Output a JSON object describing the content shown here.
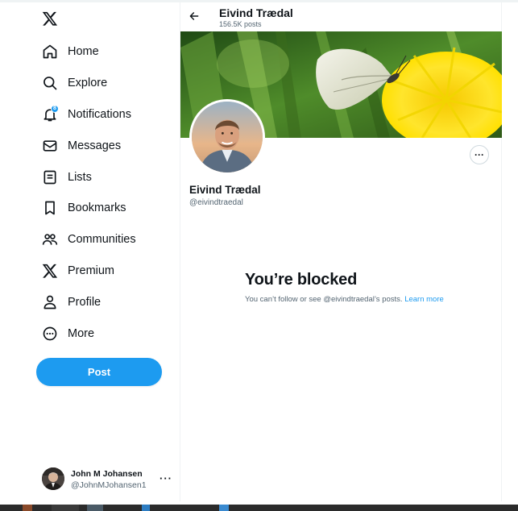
{
  "sidebar": {
    "items": [
      {
        "label": "Home",
        "icon": "home-icon"
      },
      {
        "label": "Explore",
        "icon": "search-icon"
      },
      {
        "label": "Notifications",
        "icon": "bell-icon",
        "badge": "8"
      },
      {
        "label": "Messages",
        "icon": "mail-icon"
      },
      {
        "label": "Lists",
        "icon": "list-icon"
      },
      {
        "label": "Bookmarks",
        "icon": "bookmark-icon"
      },
      {
        "label": "Communities",
        "icon": "communities-icon"
      },
      {
        "label": "Premium",
        "icon": "x-logo-icon"
      },
      {
        "label": "Profile",
        "icon": "person-icon"
      },
      {
        "label": "More",
        "icon": "more-circle-icon"
      }
    ],
    "post_label": "Post",
    "account": {
      "name": "John M Johansen",
      "handle": "@JohnMJohansen1",
      "more": "···"
    }
  },
  "header": {
    "name": "Eivind Trædal",
    "posts": "156.5K posts"
  },
  "profile": {
    "name": "Eivind Trædal",
    "handle": "@eivindtraedal",
    "more": "···"
  },
  "blocked": {
    "title": "You’re blocked",
    "text": "You can’t follow or see @eivindtraedal’s posts.",
    "link": "Learn more"
  },
  "colors": {
    "accent": "#1d9bf0",
    "text": "#0f1419",
    "muted": "#536471"
  }
}
